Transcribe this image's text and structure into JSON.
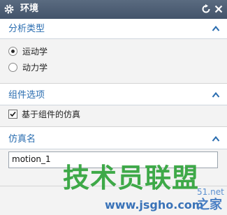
{
  "window": {
    "title": "环境"
  },
  "sections": {
    "analysis_type": {
      "label": "分析类型",
      "options": [
        {
          "label": "运动学",
          "selected": true
        },
        {
          "label": "动力学",
          "selected": false
        }
      ]
    },
    "component_options": {
      "label": "组件选项",
      "checkbox": {
        "label": "基于组件的仿真",
        "checked": true
      }
    },
    "simulation_name": {
      "label": "仿真名",
      "value": "motion_1"
    }
  },
  "watermark": {
    "main": "技术员联盟",
    "url": "www.jsgho.com",
    "side": "51.net",
    "suffix": "之家"
  },
  "colors": {
    "title_bar": "#4a5a70",
    "section_label": "#2a6db0",
    "watermark_green": "#2fa33a"
  }
}
